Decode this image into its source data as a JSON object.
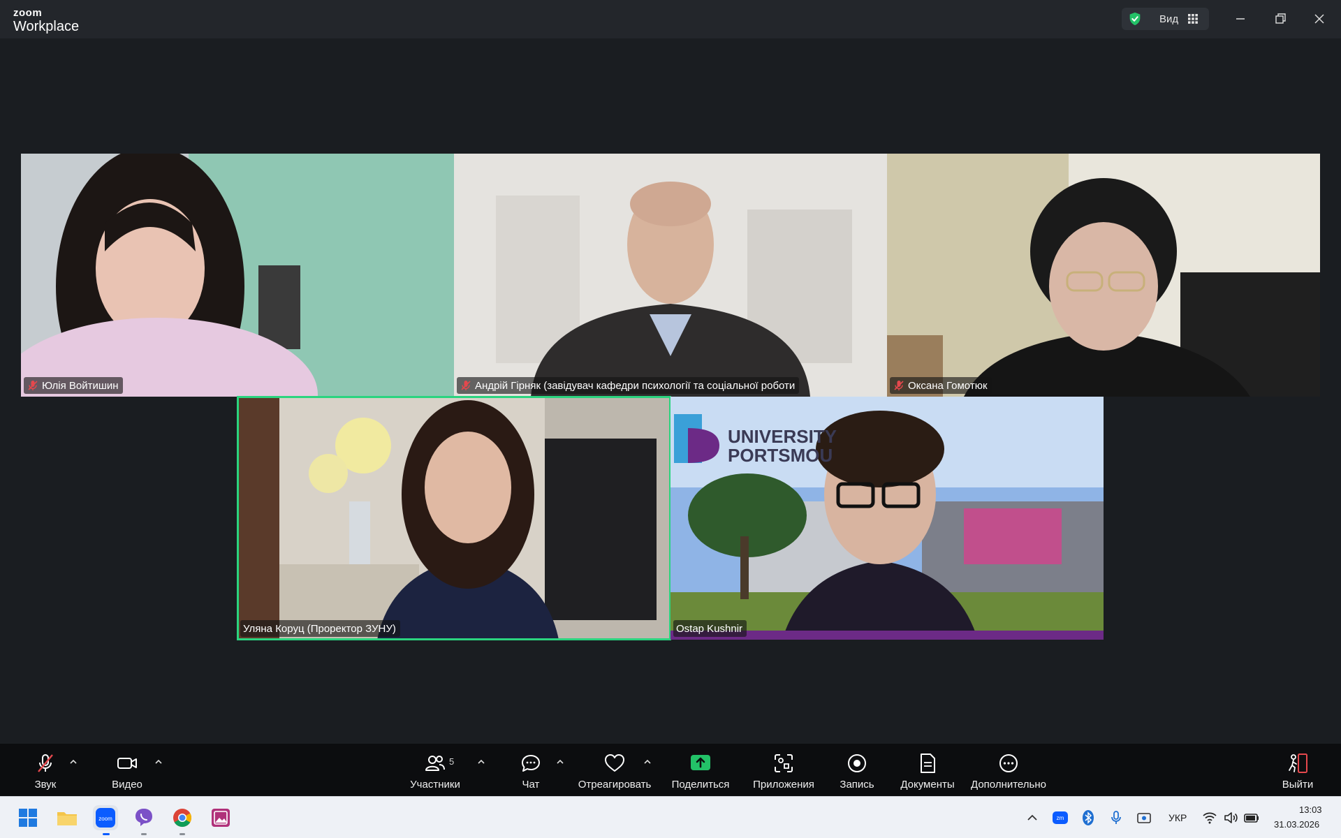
{
  "app": {
    "brand_top": "zoom",
    "brand_bottom": "Workplace",
    "view_label": "Вид"
  },
  "participants": [
    {
      "name": "Юлія Войтишин",
      "muted": true
    },
    {
      "name": "Андрій Гірняк (завідувач кафедри психології та соціальної роботи",
      "muted": true
    },
    {
      "name": "Оксана Гомотюк",
      "muted": true
    },
    {
      "name": "Уляна Коруц (Проректор ЗУНУ)",
      "muted": false,
      "active_speaker": true
    },
    {
      "name": "Ostap Kushnir",
      "muted": false
    }
  ],
  "backdrop_text": {
    "line1": "UNIVERSITY",
    "line2": "PORTSMOU"
  },
  "toolbar": {
    "audio": "Звук",
    "video": "Видео",
    "participants": "Участники",
    "participants_count": "5",
    "chat": "Чат",
    "react": "Отреагировать",
    "share": "Поделиться",
    "apps": "Приложения",
    "record": "Запись",
    "docs": "Документы",
    "more": "Дополнительно",
    "leave": "Выйти"
  },
  "taskbar": {
    "language": "УКР",
    "time": "13:03",
    "date": "31.03.2026"
  },
  "colors": {
    "accent_green": "#2bd47f",
    "share_green": "#23c268",
    "leave_red": "#e5484d",
    "muted_red": "#e5484d"
  }
}
